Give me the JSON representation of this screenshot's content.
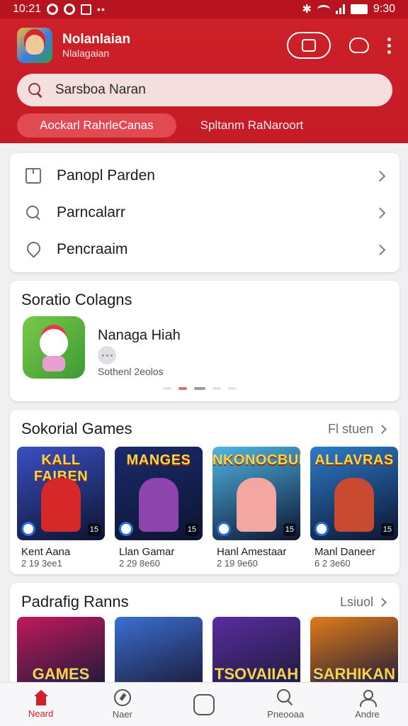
{
  "status_bar": {
    "time": "10:21",
    "clock": "9:30"
  },
  "header": {
    "title": "Nolanlaian",
    "subtitle": "Nlalagaian",
    "search_value": "Sarsboa Naran",
    "tabs": [
      {
        "label": "Aockarl RahrleCanas",
        "active": true
      },
      {
        "label": "Spltanm RaNaroort",
        "active": false
      }
    ]
  },
  "menu": {
    "items": [
      {
        "label": "Panopl Parden",
        "icon": "folder-icon"
      },
      {
        "label": "Parncalarr",
        "icon": "search-icon"
      },
      {
        "label": "Pencraaim",
        "icon": "location-pin-icon"
      }
    ]
  },
  "featured": {
    "title": "Soratio Colagns",
    "app_name": "Nanaga Hiah",
    "meta": "Sothenl 2eolos"
  },
  "games": {
    "title": "Sokorial Games",
    "see_all": "Fl stuen",
    "items": [
      {
        "art_text": "KALL FAIBEN",
        "name": "Kent Aana",
        "meta": "2 19 3ee1",
        "badge": "15",
        "bg": "#3a4fc4",
        "accent": "#d62828"
      },
      {
        "art_text": "MANGES",
        "name": "Llan Gamar",
        "meta": "2 29 8e60",
        "badge": "15",
        "bg": "#1a2b6d",
        "accent": "#8e44ad"
      },
      {
        "art_text": "NKONOCBUR",
        "name": "Hanl Amestaar",
        "meta": "2 19 9e60",
        "badge": "15",
        "bg": "#4fb6e6",
        "accent": "#f4a6a0"
      },
      {
        "art_text": "ALLAVRAS",
        "name": "Manl Daneer",
        "meta": "6 2 3e60",
        "badge": "15",
        "bg": "#2d7bc9",
        "accent": "#c84b31"
      }
    ]
  },
  "popular": {
    "title": "Padrafig Ranns",
    "see_all": "Lsiuol",
    "items": [
      {
        "art_text": "GAMES",
        "bg": "#c2185b"
      },
      {
        "art_text": "",
        "bg": "#3b6fd1"
      },
      {
        "art_text": "TSOVAIIAH",
        "bg": "#5a2ca0"
      },
      {
        "art_text": "SARHIKAN",
        "bg": "#e07b1a"
      }
    ]
  },
  "bottom_nav": {
    "items": [
      {
        "label": "Neard",
        "active": true
      },
      {
        "label": "Naer",
        "active": false
      },
      {
        "label": "",
        "active": false
      },
      {
        "label": "Pneooaa",
        "active": false
      },
      {
        "label": "Andre",
        "active": false
      }
    ]
  },
  "colors": {
    "brand": "#c81e26",
    "accent_red": "#d0202a"
  }
}
